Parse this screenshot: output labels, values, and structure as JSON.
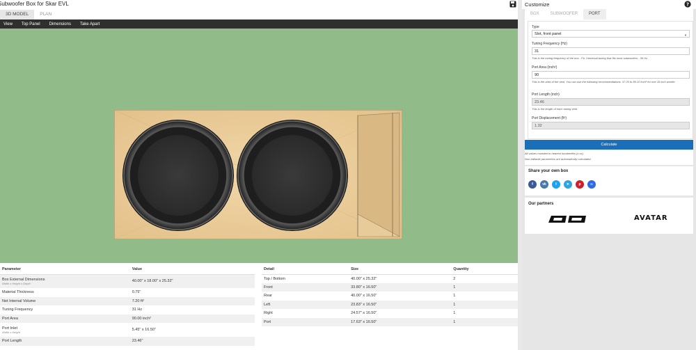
{
  "app": {
    "title": "Subwoofer Box for Skar EVL",
    "view_tabs": [
      {
        "label": "3D MODEL",
        "active": true
      },
      {
        "label": "PLAN",
        "active": false
      }
    ],
    "menu": [
      "View",
      "Top Panel",
      "Dimensions",
      "Take Apart"
    ]
  },
  "params_table": {
    "headers": [
      "Parameter",
      "Value"
    ],
    "rows": [
      {
        "name": "Box External Dimensions",
        "sub": "Width x Height x Depth",
        "value": "40.00\" x 18.00\" x 25.32\""
      },
      {
        "name": "Material Thickness",
        "sub": "",
        "value": "0.75\""
      },
      {
        "name": "Net Internal Volume",
        "sub": "",
        "value": "7.20 ft³"
      },
      {
        "name": "Tuning Frequency",
        "sub": "",
        "value": "31 Hz"
      },
      {
        "name": "Port Area",
        "sub": "",
        "value": "90.00 inch²"
      },
      {
        "name": "Port Inlet",
        "sub": "Width x Height",
        "value": "5.45\" x 16.50\""
      },
      {
        "name": "Port Length",
        "sub": "",
        "value": "23.46\""
      }
    ]
  },
  "detail_table": {
    "headers": [
      "Detail",
      "Size",
      "Quantity"
    ],
    "rows": [
      {
        "name": "Top / Bottom",
        "size": "40.00\" x 25.32\"",
        "qty": "2"
      },
      {
        "name": "Front",
        "size": "33.80\" x 16.50\"",
        "qty": "1"
      },
      {
        "name": "Rear",
        "size": "40.00\" x 16.50\"",
        "qty": "1"
      },
      {
        "name": "Left",
        "size": "23.83\" x 16.50\"",
        "qty": "1"
      },
      {
        "name": "Right",
        "size": "24.57\" x 16.50\"",
        "qty": "1"
      },
      {
        "name": "Port",
        "size": "17.63\" x 16.50\"",
        "qty": "1"
      }
    ]
  },
  "customize": {
    "title": "Customize",
    "tabs": [
      {
        "label": "BOX",
        "active": false
      },
      {
        "label": "SUBWOOFER",
        "active": false
      },
      {
        "label": "PORT",
        "active": true
      }
    ],
    "type_label": "Type",
    "type_value": "Slot, front panel",
    "tuning_label": "Tuning Frequency (Hz)",
    "tuning_value": "31",
    "tuning_help": "This is the tuning frequency of the box - Fb. Universal tuning that fits most subwoofers - 36 Hz",
    "area_label": "Port Area (inch²)",
    "area_value": "90",
    "area_help": "This is the area of the vent. You can use the following recommendations: 37.20 to 85.10 inch² for one 15 inch woofer",
    "length_label": "Port Length (inch)",
    "length_value": "23.46",
    "length_help": "This is the length of each tuning vent",
    "disp_label": "Port Displacement (ft³)",
    "disp_value": "1.32",
    "calculate_label": "Calculate",
    "note1": "All values rounded to nearest hundredths (x.xx).",
    "note2": "Non-editable parameters are automatically calculated."
  },
  "share": {
    "title": "Share your own box",
    "icons": [
      {
        "name": "facebook-icon",
        "glyph": "f",
        "color": "#3b5998"
      },
      {
        "name": "vk-icon",
        "glyph": "vk",
        "color": "#4a76a8"
      },
      {
        "name": "twitter-icon",
        "glyph": "t",
        "color": "#1da1f2"
      },
      {
        "name": "telegram-icon",
        "glyph": "➤",
        "color": "#2ca5e0"
      },
      {
        "name": "pinterest-icon",
        "glyph": "p",
        "color": "#cb2027"
      },
      {
        "name": "link-icon",
        "glyph": "∞",
        "color": "#2e6be6"
      }
    ]
  },
  "partners": {
    "title": "Our partners",
    "logo_dd": "DD",
    "logo_avatar": "AVATAR"
  },
  "colors": {
    "viewport_bg": "#92bb8a",
    "accent": "#1b6fb8",
    "menubar": "#2f2f2f"
  }
}
